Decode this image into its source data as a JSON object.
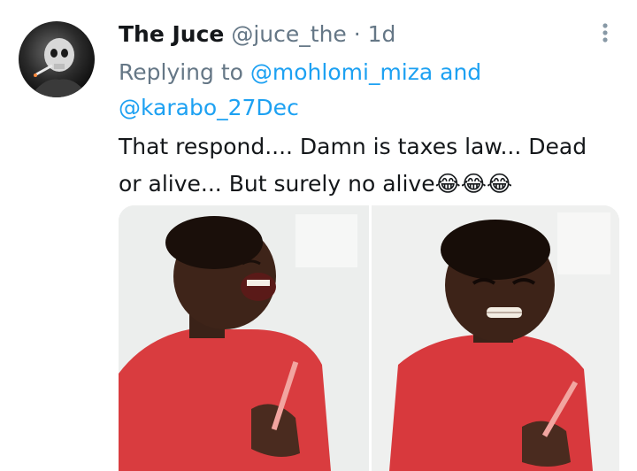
{
  "tweet": {
    "author_name": "The Juce",
    "author_handle": "@juce_the",
    "separator": "·",
    "time": "1d",
    "reply": {
      "prefix": "Replying to",
      "mention_1": "@mohlomi_miza",
      "joiner": "and",
      "mention_2": "@karabo_27Dec"
    },
    "text": "That respond.... Damn is taxes law... Dead or alive... But surely no alive😂😂😂",
    "avatar_icon": "avatar-image",
    "more_icon": "more-vertical-icon",
    "media": {
      "panels": [
        "photo-boy-laughing",
        "photo-boy-grimacing"
      ]
    }
  },
  "colors": {
    "handle_gray": "#657786",
    "mention_blue": "#1da1f2",
    "text": "#14171a"
  }
}
